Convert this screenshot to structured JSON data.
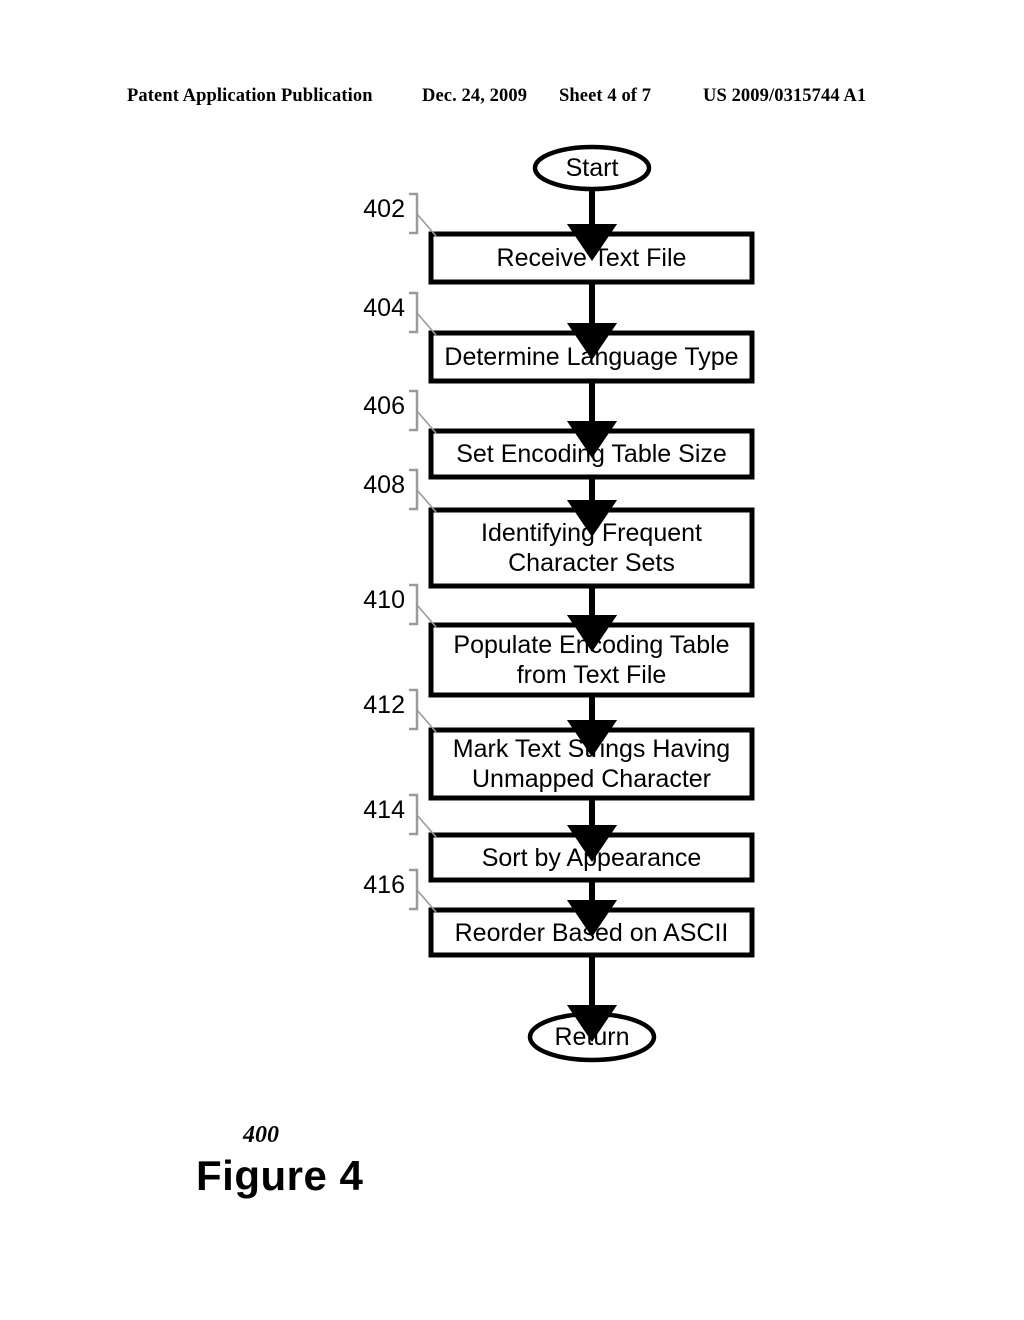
{
  "header": {
    "publication": "Patent Application Publication",
    "date": "Dec. 24, 2009",
    "sheet": "Sheet 4 of 7",
    "patent_number": "US 2009/0315744 A1"
  },
  "figure": {
    "ref_numeral": "400",
    "caption": "Figure 4"
  },
  "colors": {
    "ink": "#000000",
    "paper": "#ffffff",
    "leader": "#9a9a9a"
  },
  "flowchart": {
    "type": "flowchart",
    "orientation": "vertical",
    "start": {
      "label": "Start",
      "shape": "ellipse"
    },
    "end": {
      "label": "Return",
      "shape": "ellipse"
    },
    "steps": [
      {
        "ref": "402",
        "label": "Receive Text File",
        "shape": "process",
        "lines": 1
      },
      {
        "ref": "404",
        "label": "Determine Language Type",
        "shape": "process",
        "lines": 1
      },
      {
        "ref": "406",
        "label": "Set Encoding Table Size",
        "shape": "process",
        "lines": 1
      },
      {
        "ref": "408",
        "label": "Identifying Frequent Character Sets",
        "shape": "process",
        "lines": 2
      },
      {
        "ref": "410",
        "label": "Populate Encoding Table from Text File",
        "shape": "process",
        "lines": 2
      },
      {
        "ref": "412",
        "label": "Mark Text Strings Having Unmapped Character",
        "shape": "process",
        "lines": 2
      },
      {
        "ref": "414",
        "label": "Sort by Appearance",
        "shape": "process",
        "lines": 1
      },
      {
        "ref": "416",
        "label": "Reorder Based on ASCII",
        "shape": "process",
        "lines": 1
      }
    ]
  }
}
